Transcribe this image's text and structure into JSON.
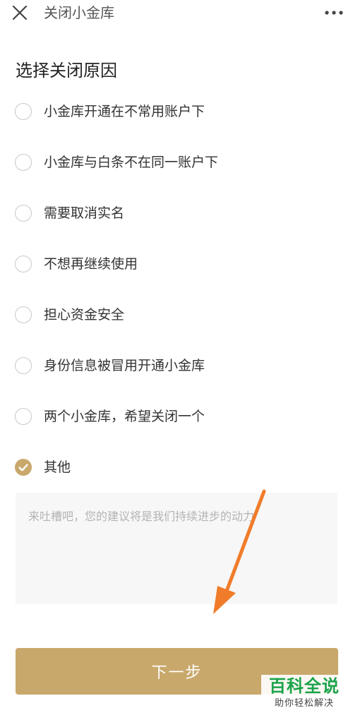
{
  "header": {
    "title": "关闭小金库",
    "close_icon": "close-icon",
    "more_icon": "more-icon"
  },
  "section_title": "选择关闭原因",
  "options": [
    {
      "label": "小金库开通在不常用账户下",
      "checked": false
    },
    {
      "label": "小金库与白条不在同一账户下",
      "checked": false
    },
    {
      "label": "需要取消实名",
      "checked": false
    },
    {
      "label": "不想再继续使用",
      "checked": false
    },
    {
      "label": "担心资金安全",
      "checked": false
    },
    {
      "label": "身份信息被冒用开通小金库",
      "checked": false
    },
    {
      "label": "两个小金库，希望关闭一个",
      "checked": false
    },
    {
      "label": "其他",
      "checked": true
    }
  ],
  "feedback": {
    "value": "",
    "placeholder": "来吐槽吧，您的建议将是我们持续进步的动力"
  },
  "next_button": {
    "label": "下一步"
  },
  "watermark": {
    "main": "百科全说",
    "sub": "助你轻松解决"
  },
  "colors": {
    "accent": "#c9a86c",
    "arrow": "#f07c2a",
    "watermark_green": "#1aa34a"
  }
}
